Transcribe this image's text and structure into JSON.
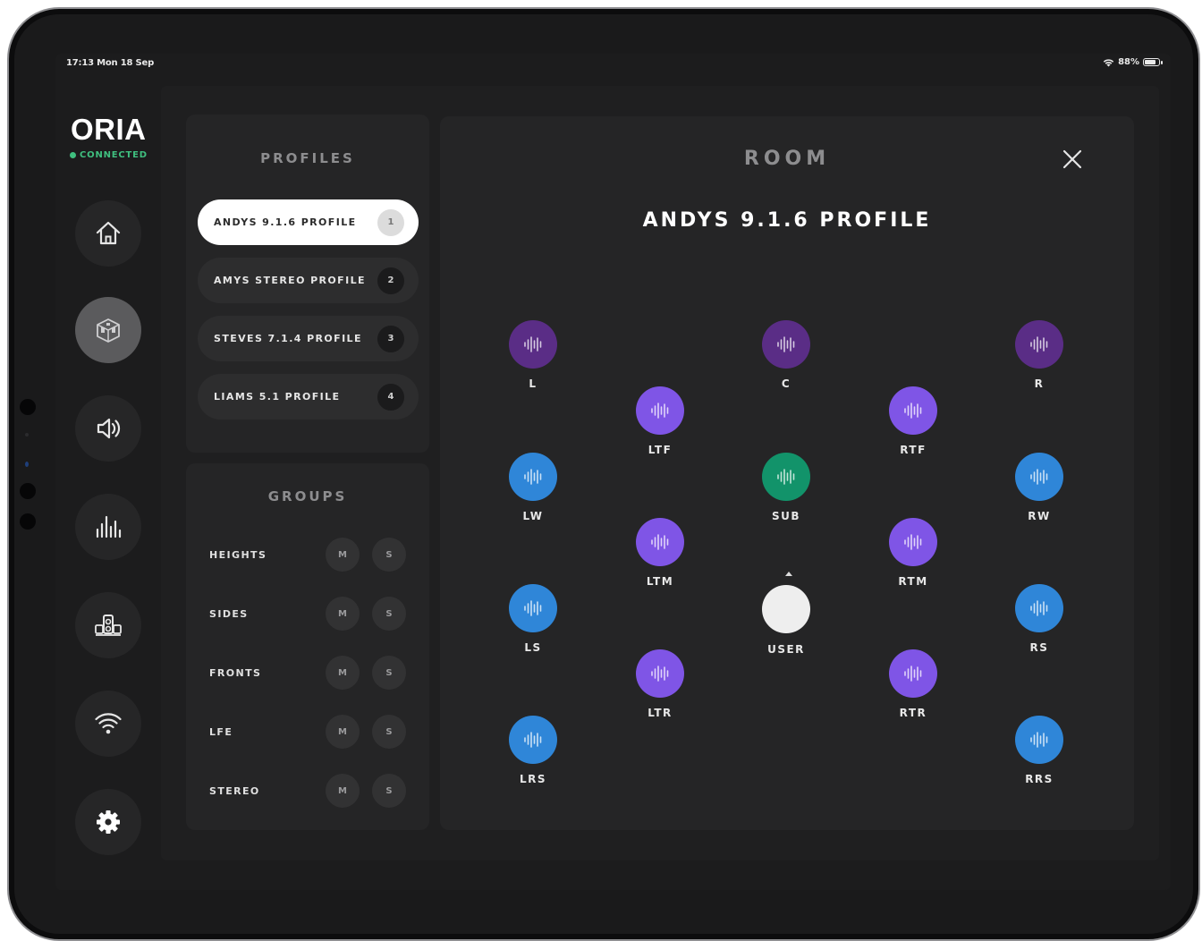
{
  "status_bar": {
    "time_date": "17:13  Mon 18 Sep",
    "battery": "88%"
  },
  "brand": {
    "name": "ORIA",
    "status": "CONNECTED"
  },
  "nav": [
    {
      "icon": "home-icon"
    },
    {
      "icon": "room-icon",
      "active": true
    },
    {
      "icon": "speaker-icon"
    },
    {
      "icon": "equalizer-icon"
    },
    {
      "icon": "speakers-icon"
    },
    {
      "icon": "wifi-icon"
    },
    {
      "icon": "settings-icon"
    }
  ],
  "profiles": {
    "title": "PROFILES",
    "items": [
      {
        "label": "ANDYS 9.1.6 PROFILE",
        "num": "1",
        "active": true
      },
      {
        "label": "AMYS STEREO PROFILE",
        "num": "2"
      },
      {
        "label": "STEVES 7.1.4 PROFILE",
        "num": "3"
      },
      {
        "label": "LIAMS 5.1 PROFILE",
        "num": "4"
      }
    ]
  },
  "groups": {
    "title": "GROUPS",
    "mute_label": "M",
    "solo_label": "S",
    "items": [
      {
        "label": "HEIGHTS"
      },
      {
        "label": "SIDES"
      },
      {
        "label": "FRONTS"
      },
      {
        "label": "LFE"
      },
      {
        "label": "STEREO"
      }
    ]
  },
  "room": {
    "title": "ROOM",
    "profile_name": "ANDYS 9.1.6 PROFILE",
    "speakers": [
      {
        "label": "L",
        "type": "front"
      },
      {
        "label": "C",
        "type": "front"
      },
      {
        "label": "R",
        "type": "front"
      },
      {
        "label": "LTF",
        "type": "height"
      },
      {
        "label": "RTF",
        "type": "height"
      },
      {
        "label": "LW",
        "type": "side"
      },
      {
        "label": "SUB",
        "type": "lfe"
      },
      {
        "label": "RW",
        "type": "side"
      },
      {
        "label": "LTM",
        "type": "height"
      },
      {
        "label": "RTM",
        "type": "height"
      },
      {
        "label": "LS",
        "type": "side"
      },
      {
        "label": "RS",
        "type": "side"
      },
      {
        "label": "LTR",
        "type": "height"
      },
      {
        "label": "RTR",
        "type": "height"
      },
      {
        "label": "LRS",
        "type": "side"
      },
      {
        "label": "RRS",
        "type": "side"
      }
    ],
    "user_label": "USER"
  },
  "colors": {
    "front": "#5a2d86",
    "height": "#7f55e6",
    "side": "#2f86d8",
    "lfe": "#12936a",
    "connected": "#3fbf7f"
  }
}
